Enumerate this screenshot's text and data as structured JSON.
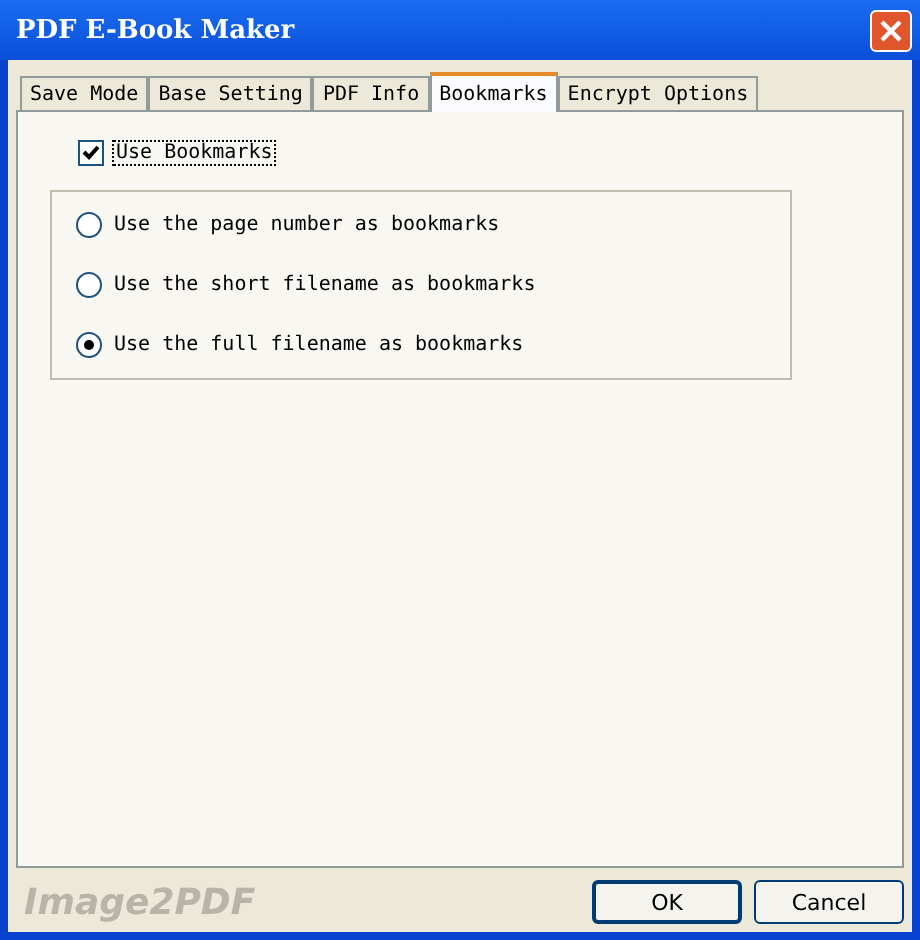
{
  "window": {
    "title": "PDF E-Book Maker"
  },
  "tabs": [
    {
      "label": "Save Mode",
      "selected": false
    },
    {
      "label": "Base Setting",
      "selected": false
    },
    {
      "label": "PDF Info",
      "selected": false
    },
    {
      "label": "Bookmarks",
      "selected": true
    },
    {
      "label": "Encrypt Options",
      "selected": false
    }
  ],
  "use_bookmarks": {
    "label": "Use Bookmarks",
    "checked": true
  },
  "options": [
    {
      "label": "Use the page number as bookmarks",
      "selected": false
    },
    {
      "label": "Use the short filename as bookmarks",
      "selected": false
    },
    {
      "label": "Use the full filename as bookmarks",
      "selected": true
    }
  ],
  "brand": "Image2PDF",
  "buttons": [
    "OK",
    "Cancel"
  ]
}
